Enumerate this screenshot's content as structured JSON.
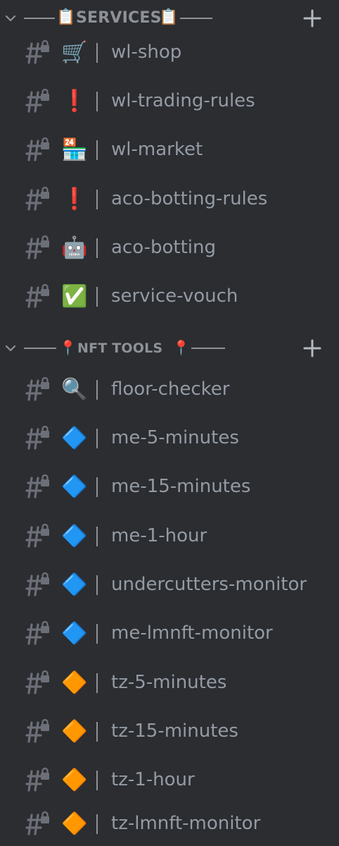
{
  "categories": [
    {
      "title": "SERVICES",
      "emoji_left": "📋",
      "emoji_right": "📋",
      "chevron_icon": "chevron-down-icon",
      "add_icon": "plus-icon",
      "channels": [
        {
          "emoji": "🛒",
          "name": "wl-shop"
        },
        {
          "emoji": "❗",
          "name": "wl-trading-rules"
        },
        {
          "emoji": "🏪",
          "name": "wl-market"
        },
        {
          "emoji": "❗",
          "name": "aco-botting-rules"
        },
        {
          "emoji": "🤖",
          "name": "aco-botting"
        },
        {
          "emoji": "✅",
          "name": "service-vouch"
        }
      ]
    },
    {
      "title": "NFT TOOLS",
      "emoji_left": "📍",
      "emoji_right": "📍",
      "chevron_icon": "chevron-down-icon",
      "add_icon": "plus-icon",
      "channels": [
        {
          "emoji": "🔍",
          "name": "floor-checker"
        },
        {
          "emoji": "🔷",
          "name": "me-5-minutes"
        },
        {
          "emoji": "🔷",
          "name": "me-15-minutes"
        },
        {
          "emoji": "🔷",
          "name": "me-1-hour"
        },
        {
          "emoji": "🔷",
          "name": "undercutters-monitor"
        },
        {
          "emoji": "🔷",
          "name": "me-lmnft-monitor"
        },
        {
          "emoji": "🔶",
          "name": "tz-5-minutes"
        },
        {
          "emoji": "🔶",
          "name": "tz-15-minutes"
        },
        {
          "emoji": "🔶",
          "name": "tz-1-hour"
        },
        {
          "emoji": "🔶",
          "name": "tz-lmnft-monitor"
        }
      ]
    }
  ],
  "channel_icon": "locked-text-channel-icon",
  "colors": {
    "background": "#2b2d31",
    "muted_text": "#949ba4",
    "category_text": "#8e9297",
    "blue_diamond": "#4a90e2",
    "orange_diamond": "#f6a623"
  }
}
